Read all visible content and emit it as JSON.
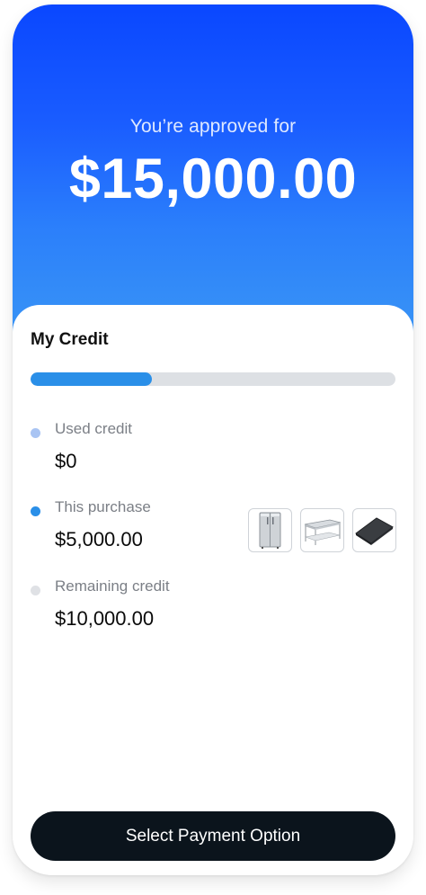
{
  "header": {
    "approved_label": "You’re approved for",
    "approved_amount": "$15,000.00"
  },
  "credit": {
    "title": "My Credit",
    "progress_fraction": 0.333,
    "items": [
      {
        "label": "Used credit",
        "value": "$0",
        "dot_color": "#a9c4f3"
      },
      {
        "label": "This purchase",
        "value": "$5,000.00",
        "dot_color": "#2a8fe8"
      },
      {
        "label": "Remaining credit",
        "value": "$10,000.00",
        "dot_color": "#dfe1e5"
      }
    ],
    "product_icons": [
      "refrigerator-icon",
      "steel-table-icon",
      "floor-mat-icon"
    ]
  },
  "footer": {
    "cta_label": "Select Payment Option"
  },
  "colors": {
    "brand_blue": "#0a47ff",
    "accent_blue": "#2a8fe8",
    "cta_dark": "#0b141c"
  }
}
